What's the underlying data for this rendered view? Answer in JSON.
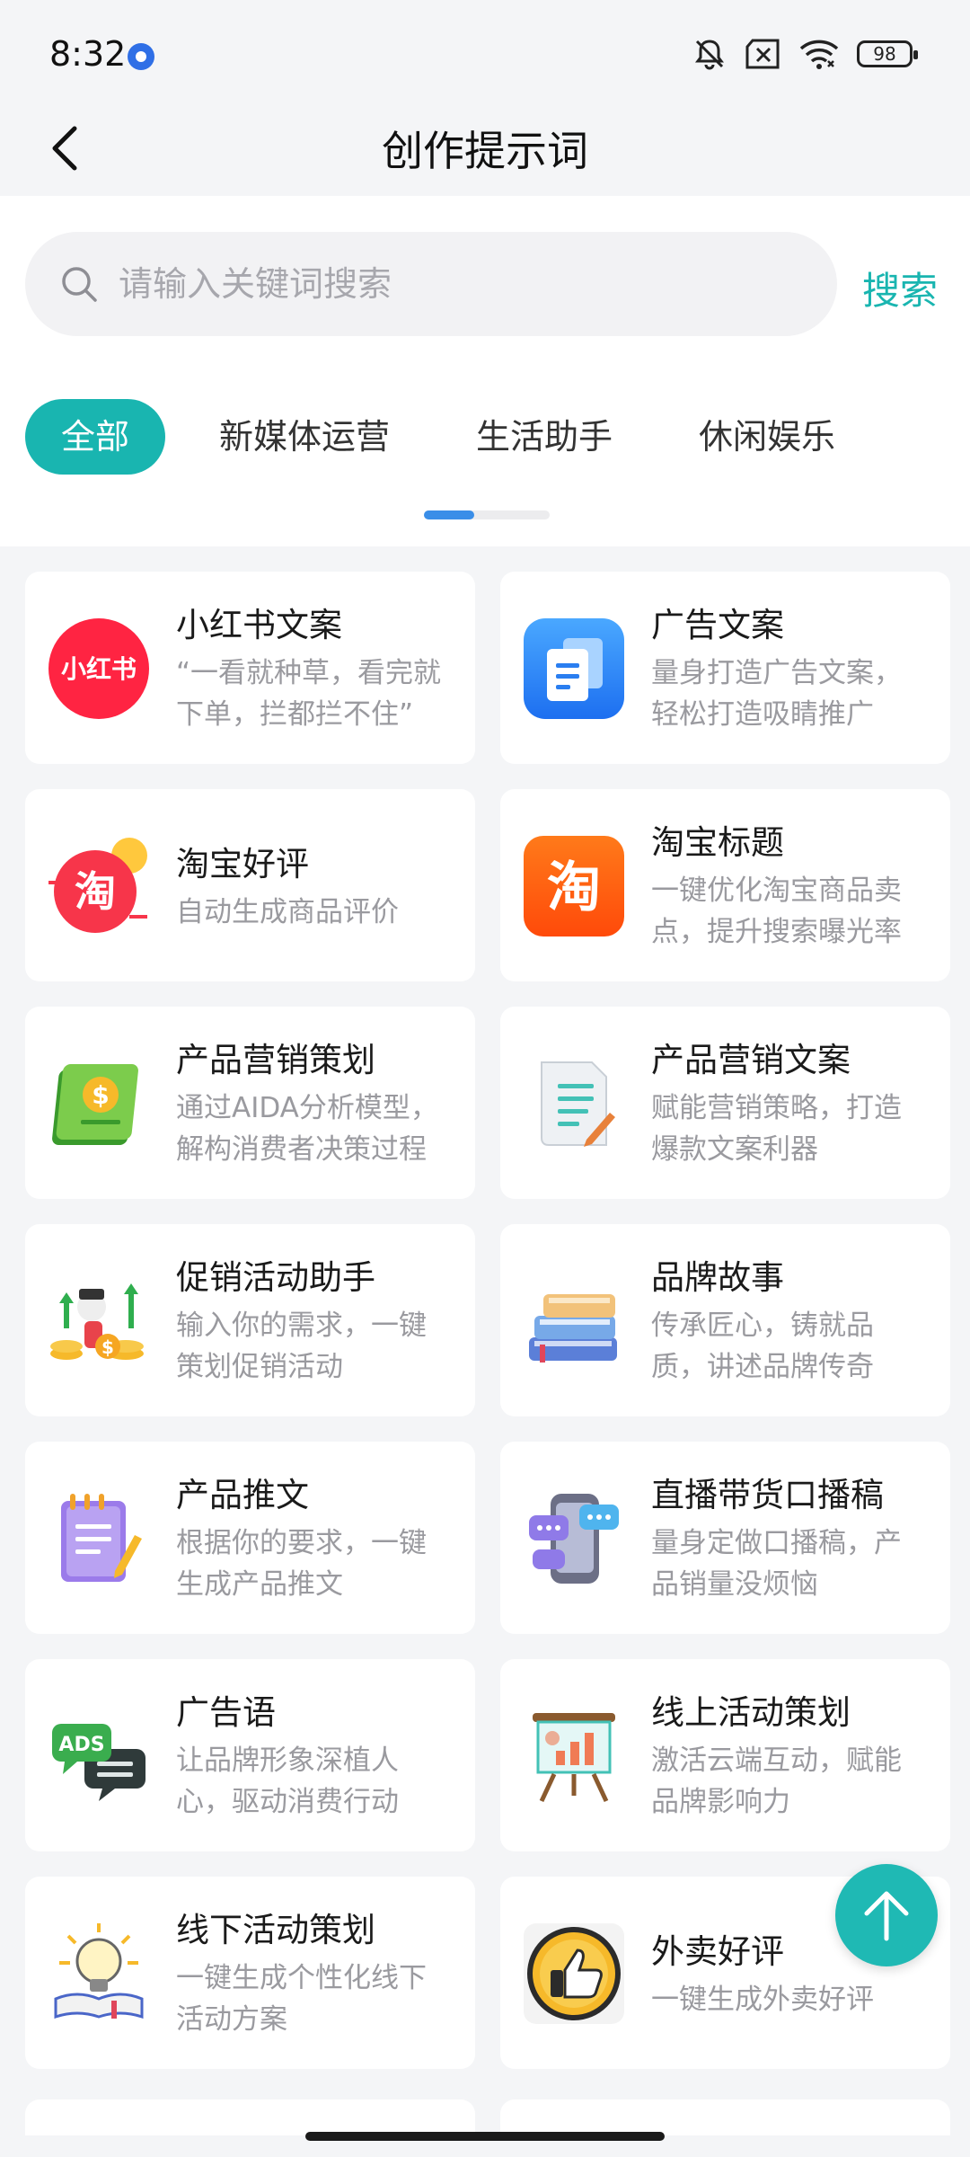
{
  "status_bar": {
    "time": "8:32",
    "battery": "98"
  },
  "nav": {
    "title": "创作提示词"
  },
  "search": {
    "placeholder": "请输入关键词搜索",
    "button": "搜索"
  },
  "tabs": [
    "全部",
    "新媒体运营",
    "生活助手",
    "休闲娱乐"
  ],
  "cards": [
    {
      "title": "小红书文案",
      "desc": "“一看就种草，看完就下单，拦都拦不住”",
      "icon": "xiaohongshu-logo-icon",
      "logo_text": "小红书"
    },
    {
      "title": "广告文案",
      "desc": "量身打造广告文案，轻松打造吸睛推广",
      "icon": "document-copy-icon"
    },
    {
      "title": "淘宝好评",
      "desc": "自动生成商品评价",
      "icon": "taobao-review-icon",
      "logo_text": "淘"
    },
    {
      "title": "淘宝标题",
      "desc": "一键优化淘宝商品卖点，提升搜索曝光率",
      "icon": "taobao-logo-icon",
      "logo_text": "淘"
    },
    {
      "title": "产品营销策划",
      "desc": "通过AIDA分析模型，解构消费者决策过程",
      "icon": "money-book-icon"
    },
    {
      "title": "产品营销文案",
      "desc": "赋能营销策略，打造爆款文案利器",
      "icon": "paper-pen-icon"
    },
    {
      "title": "促销活动助手",
      "desc": "输入你的需求，一键策划促销活动",
      "icon": "promotion-coins-icon"
    },
    {
      "title": "品牌故事",
      "desc": "传承匠心，铸就品质，讲述品牌传奇",
      "icon": "stacked-books-icon"
    },
    {
      "title": "产品推文",
      "desc": "根据你的要求，一键生成产品推文",
      "icon": "notepad-pencil-icon"
    },
    {
      "title": "直播带货口播稿",
      "desc": "量身定做口播稿，产品销量没烦恼",
      "icon": "phone-chat-icon"
    },
    {
      "title": "广告语",
      "desc": "让品牌形象深植人心，驱动消费行动",
      "icon": "ads-bubble-icon",
      "logo_text": "ADS"
    },
    {
      "title": "线上活动策划",
      "desc": "激活云端互动，赋能品牌影响力",
      "icon": "presentation-board-icon"
    },
    {
      "title": "线下活动策划",
      "desc": "一键生成个性化线下活动方案",
      "icon": "lightbulb-book-icon"
    },
    {
      "title": "外卖好评",
      "desc": "一键生成外卖好评",
      "icon": "thumbs-up-badge-icon"
    }
  ],
  "colors": {
    "accent": "#19b5b0",
    "indicator": "#3a8ee8"
  }
}
